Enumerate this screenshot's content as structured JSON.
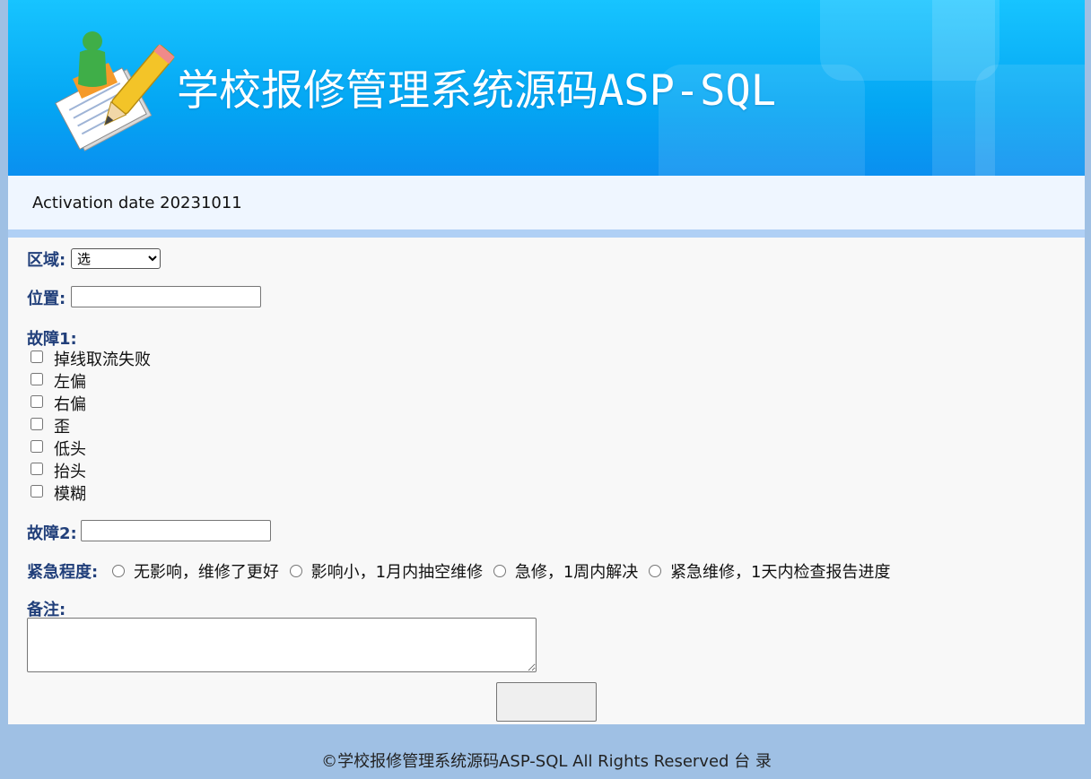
{
  "header": {
    "title": "学校报修管理系统源码ASP-SQL",
    "logo_icon": "notepad-pencil-user-icon"
  },
  "infobar": {
    "text": "Activation date 20231011"
  },
  "form": {
    "region_label": "区域:",
    "region_selected": "选",
    "location_label": "位置:",
    "location_value": "",
    "fault1_label": "故障1:",
    "fault1_options": [
      "掉线取流失败",
      "左偏",
      "右偏",
      "歪",
      "低头",
      "抬头",
      "模糊"
    ],
    "fault2_label": "故障2:",
    "fault2_value": "",
    "urgency_label": "紧急程度:",
    "urgency_options": [
      "无影响，维修了更好",
      "影响小，1月内抽空维修",
      "急修，1周内解决",
      "紧急维修，1天内检查报告进度"
    ],
    "notes_label": "备注:",
    "notes_value": "",
    "submit_label": ""
  },
  "footer": {
    "text": "©学校报修管理系统源码ASP-SQL All Rights Reserved 台 录"
  },
  "colors": {
    "header_gradient_top": "#17c4ff",
    "label_blue": "#213f7a",
    "footer_bg": "#9fc0e4",
    "divider": "#b0d0f5"
  }
}
